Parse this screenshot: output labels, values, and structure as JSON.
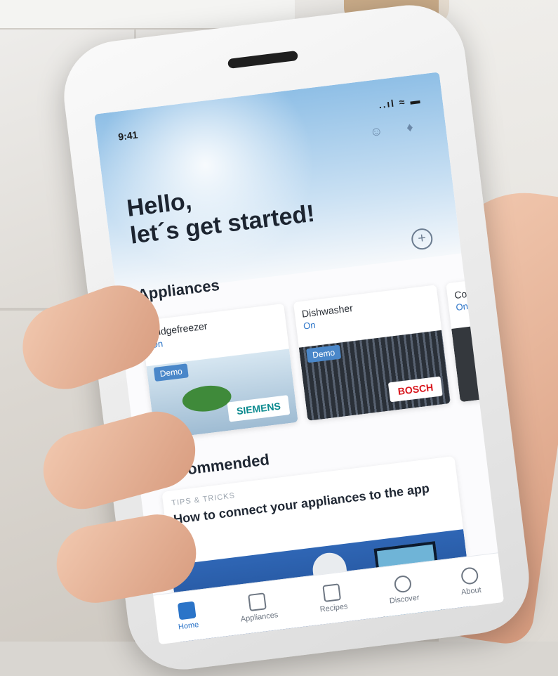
{
  "status": {
    "time": "9:41",
    "signal": "..ıl ≈ ▬"
  },
  "header": {
    "greeting_line1": "Hello,",
    "greeting_line2": "let´s get started!"
  },
  "sections": {
    "appliances": "Appliances",
    "recommended": "Recommended"
  },
  "appliances": [
    {
      "name": "Fridgefreezer",
      "state": "On",
      "demo": "Demo",
      "brand": "SIEMENS"
    },
    {
      "name": "Dishwasher",
      "state": "On",
      "demo": "Demo",
      "brand": "BOSCH"
    },
    {
      "name": "Co",
      "state": "On",
      "demo": "",
      "brand": ""
    }
  ],
  "recommended": {
    "tag": "TIPS & TRICKS",
    "title": "How to connect your appliances to the app"
  },
  "tabbar": [
    {
      "label": "Home",
      "icon": "home-icon",
      "active": true
    },
    {
      "label": "Appliances",
      "icon": "appliance-icon",
      "active": false
    },
    {
      "label": "Recipes",
      "icon": "recipe-icon",
      "active": false
    },
    {
      "label": "Discover",
      "icon": "compass-icon",
      "active": false
    },
    {
      "label": "About",
      "icon": "smiley-icon",
      "active": false
    }
  ],
  "colors": {
    "accent": "#2b74c8",
    "siemens": "#0b8a8f",
    "bosch": "#d8151b"
  }
}
